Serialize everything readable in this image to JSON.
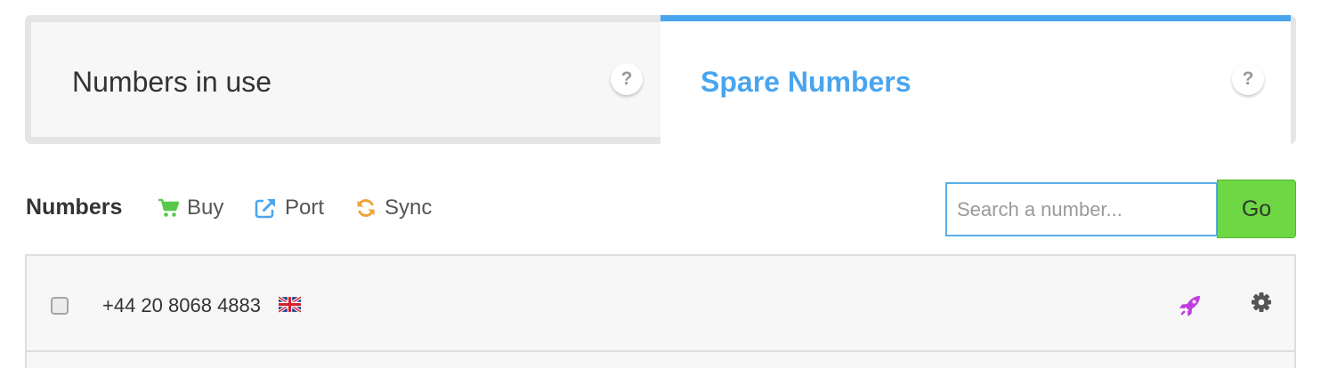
{
  "tabs": {
    "in_use": {
      "label": "Numbers in use",
      "help": "?"
    },
    "spare": {
      "label": "Spare Numbers",
      "help": "?"
    }
  },
  "toolbar": {
    "title": "Numbers",
    "actions": {
      "buy": {
        "label": "Buy",
        "icon": "cart-icon"
      },
      "port": {
        "label": "Port",
        "icon": "external-link-icon"
      },
      "sync": {
        "label": "Sync",
        "icon": "sync-icon"
      }
    },
    "search": {
      "placeholder": "Search a number...",
      "value": ""
    },
    "go_label": "Go"
  },
  "numbers": [
    {
      "number": "+44 20 8068 4883",
      "flag": "uk-flag-icon",
      "checked": false
    }
  ],
  "colors": {
    "accent": "#4aa5ef",
    "go": "#6ed744",
    "cart": "#57c84a",
    "port": "#4aa5ef",
    "sync": "#f0a436",
    "rocket": "#c13de0",
    "gear": "#555555"
  }
}
